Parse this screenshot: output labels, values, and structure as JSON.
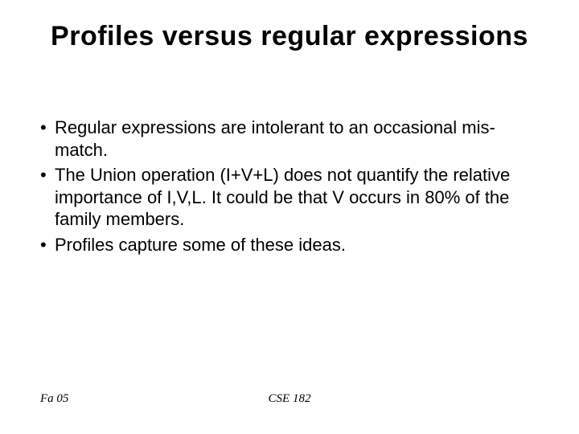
{
  "title": "Profiles versus regular expressions",
  "bullets": [
    "Regular expressions are intolerant to an occasional mis-match.",
    "The Union operation (I+V+L) does not quantify the relative importance of I,V,L. It could be that V occurs in 80% of the family members.",
    "Profiles capture some of these ideas."
  ],
  "footer": {
    "left": "Fa 05",
    "center": "CSE 182"
  }
}
